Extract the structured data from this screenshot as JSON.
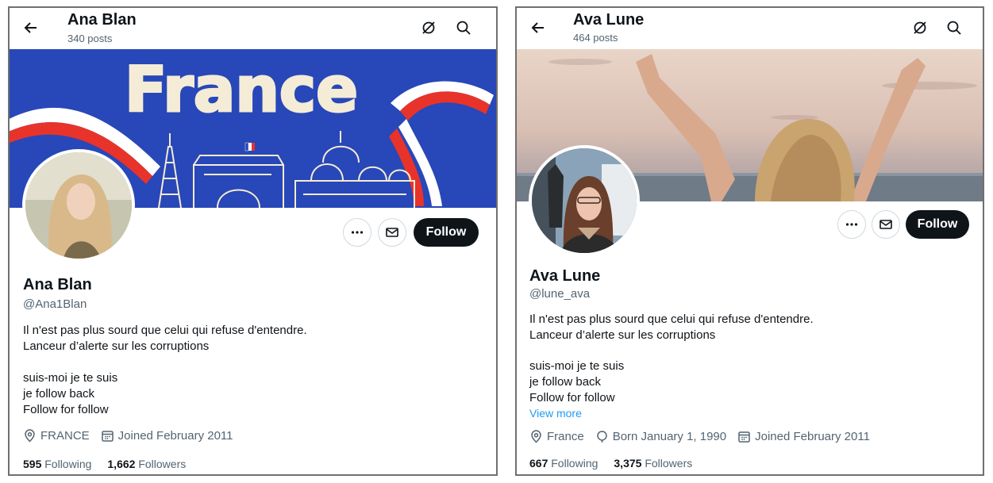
{
  "left_profile": {
    "header": {
      "name": "Ana Blan",
      "posts": "340 posts"
    },
    "banner_text": "France",
    "actions": {
      "follow_label": "Follow"
    },
    "name": "Ana Blan",
    "handle": "@Ana1Blan",
    "bio_lines": [
      "Il n'est pas plus sourd que celui qui refuse d'entendre.",
      "Lanceur d’alerte sur les corruptions",
      "",
      "suis-moi je te suis",
      "je follow back",
      "Follow for follow"
    ],
    "meta": {
      "location": "FRANCE",
      "joined": "Joined February 2011"
    },
    "stats": {
      "following_count": "595",
      "following_label": "Following",
      "followers_count": "1,662",
      "followers_label": "Followers"
    }
  },
  "right_profile": {
    "header": {
      "name": "Ava Lune",
      "posts": "464 posts"
    },
    "actions": {
      "follow_label": "Follow"
    },
    "name": "Ava Lune",
    "handle": "@lune_ava",
    "bio_lines": [
      "Il n'est pas plus sourd que celui qui refuse d'entendre.",
      "Lanceur d’alerte sur les corruptions",
      "",
      "suis-moi je te suis",
      "je follow back",
      "Follow for follow"
    ],
    "view_more": "View more",
    "meta": {
      "location": "France",
      "born": "Born January 1, 1990",
      "joined": "Joined February 2011"
    },
    "stats": {
      "following_count": "667",
      "following_label": "Following",
      "followers_count": "3,375",
      "followers_label": "Followers"
    }
  },
  "icons": [
    "back-arrow-icon",
    "grok-icon",
    "search-icon",
    "more-icon",
    "mail-icon",
    "location-icon",
    "calendar-icon",
    "birthday-icon"
  ],
  "colors": {
    "follow_bg": "#0f1419",
    "secondary_text": "#536471",
    "link": "#1d9bf0",
    "banner_blue": "#2847b8"
  }
}
